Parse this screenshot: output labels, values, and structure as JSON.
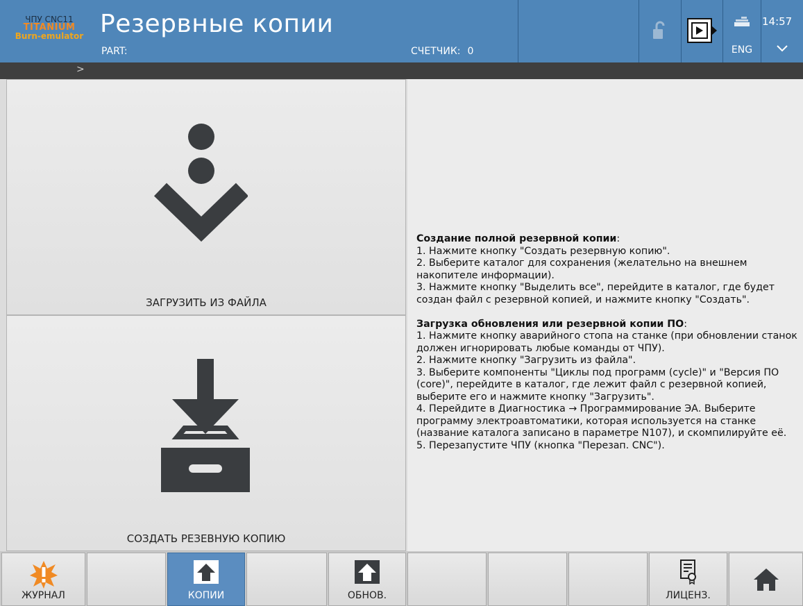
{
  "header": {
    "brand_line1": "ЧПУ CNC11",
    "brand_line2": "TITANIUM",
    "brand_line3": "Burn-emulator",
    "title": "Резервные копии",
    "part_label": "PART:",
    "counter_label": "СЧЕТЧИК:",
    "counter_value": "0",
    "language": "ENG",
    "time": "14:57",
    "icons": [
      "lock-icon",
      "monitor-icon",
      "keyboard-icon",
      "chevron-down-icon"
    ]
  },
  "breadcrumb": ">",
  "buttons": {
    "load_from_file": "ЗАГРУЗИТЬ ИЗ ФАЙЛА",
    "create_backup": "СОЗДАТЬ РЕЗЕВНУЮ КОПИЮ"
  },
  "info": {
    "section1_title": "Создание полной резервной копии",
    "section1_steps": [
      "1. Нажмите кнопку \"Создать резервную копию\".",
      "2. Выберите каталог для сохранения (желательно на внешнем накопителе информации).",
      "3. Нажмите кнопку \"Выделить все\", перейдите в каталог, где будет создан файл с резервной копией, и нажмите кнопку \"Создать\"."
    ],
    "section2_title": "Загрузка обновления или резервной копии ПО",
    "section2_steps": [
      "1. Нажмите кнопку аварийного стопа на станке (при обновлении станок должен игнорировать любые команды от ЧПУ).",
      "2. Нажмите кнопку \"Загрузить из файла\".",
      "3. Выберите компоненты \"Циклы под программ (cycle)\" и \"Версия ПО (core)\", перейдите в каталог, где лежит файл с резервной копией, выберите его и нажмите кнопку \"Загрузить\".",
      "4. Перейдите в Диагностика → Программирование ЭА. Выберите программу электроавтоматики, которая используется на станке (название каталога записано в параметре N107), и скомпилируйте её.",
      "5. Перезапустите ЧПУ (кнопка \"Перезап. CNC\")."
    ]
  },
  "toolbar": {
    "journal": "ЖУРНАЛ",
    "copies": "КОПИИ",
    "update": "ОБНОВ.",
    "license": "ЛИЦЕНЗ.",
    "active": "КОПИИ"
  },
  "colors": {
    "header_bg": "#4f86b9",
    "active_tab": "#5b8dc0",
    "warning_orange": "#f08a24",
    "icon_dark": "#3a3d40"
  }
}
